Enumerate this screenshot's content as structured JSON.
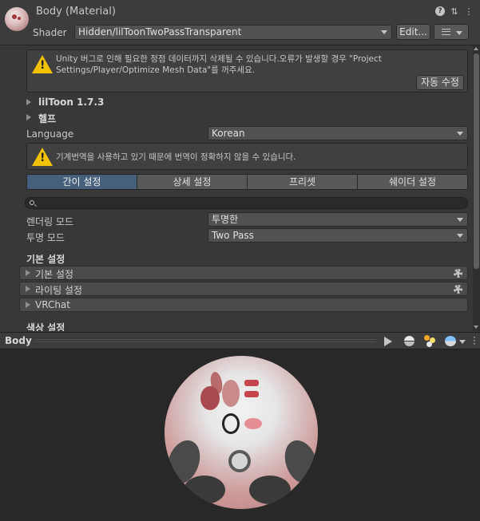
{
  "header": {
    "title": "Body (Material)",
    "shader_label": "Shader",
    "shader_value": "Hidden/lilToonTwoPassTransparent",
    "edit_label": "Edit...",
    "icons": [
      "help-icon",
      "settings-sliders-icon",
      "kebab-menu-icon"
    ]
  },
  "warning1": {
    "line1": "Unity 버그로 인해 필요한 정점 데이터까지 삭제될 수 있습니다.오류가 발생할 경우 \"Project",
    "line2": "Settings/Player/Optimize Mesh Data\"를 꺼주세요.",
    "fix_button": "자동 수정"
  },
  "foldouts": {
    "liltoon": "lilToon 1.7.3",
    "help": "헬프"
  },
  "language": {
    "label": "Language",
    "value": "Korean"
  },
  "warning2": {
    "text": "기계번역을 사용하고 있기 때문에 번역이 정확하지 않을 수 있습니다."
  },
  "tabs": [
    {
      "label": "간이 설정",
      "active": true
    },
    {
      "label": "상세 설정",
      "active": false
    },
    {
      "label": "프리셋",
      "active": false
    },
    {
      "label": "쉐이더 설정",
      "active": false
    }
  ],
  "search": {
    "placeholder": ""
  },
  "render_mode": {
    "label": "렌더링 모드",
    "value": "투명한"
  },
  "transparent_mode": {
    "label": "투명 모드",
    "value": "Two Pass"
  },
  "basic_section": {
    "title": "기본 설정",
    "groups": [
      {
        "label": "기본 설정",
        "gear": true
      },
      {
        "label": "라이팅 설정",
        "gear": true
      },
      {
        "label": "VRChat",
        "gear": false
      }
    ]
  },
  "color_section": {
    "title": "색상 설정"
  },
  "preview": {
    "name": "Body",
    "icons": [
      "play-icon",
      "sphere-mesh-icon",
      "light-icon",
      "environment-icon",
      "kebab-menu-icon"
    ]
  },
  "colors": {
    "active_tab": "#46607c",
    "warning": "#f2c200",
    "panel": "#383838",
    "preview_bg": "#282828"
  }
}
